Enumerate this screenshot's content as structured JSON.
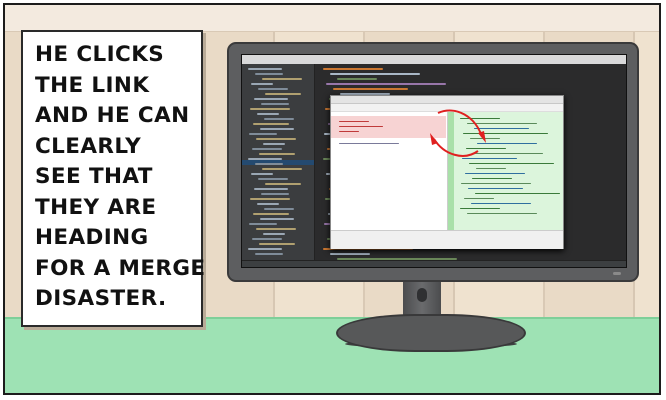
{
  "caption": {
    "lines": [
      "HE CLICKS",
      "THE LINK",
      "AND HE CAN",
      "CLEARLY",
      "SEE THAT",
      "THEY ARE",
      "HEADING",
      "FOR A MERGE",
      "DISASTER."
    ]
  },
  "colors": {
    "wall": "#e9dac6",
    "desk": "#9ee2b4",
    "monitor": "#5d5e60",
    "conflict": "#f7d3d3",
    "added": "#dcf5dc",
    "arrow": "#e02020"
  },
  "icons": [
    "merge-conflict-arrows-icon"
  ]
}
